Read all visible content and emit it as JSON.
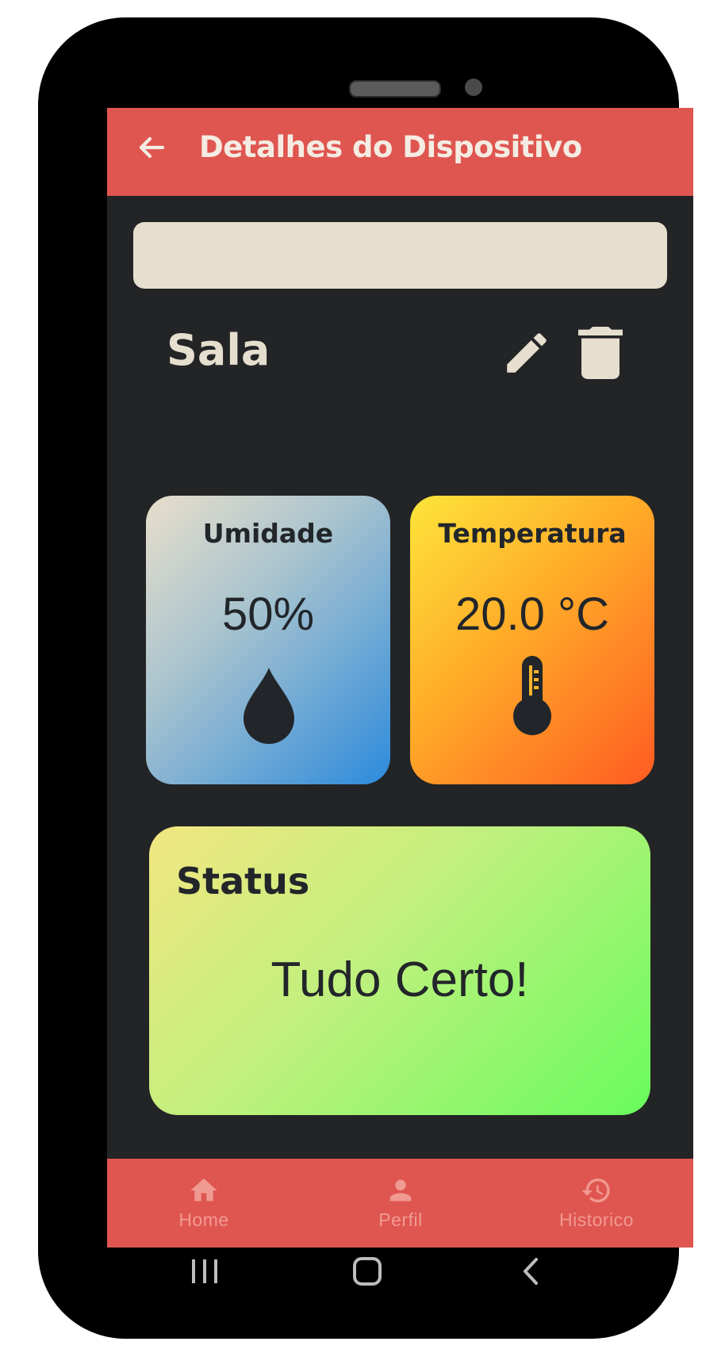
{
  "colors": {
    "app_bar": "#df5651",
    "background": "#232426",
    "banner": "#e6dece",
    "text_light": "#f4ece2",
    "text_dark": "#22262a",
    "nav_label": "#f19a91"
  },
  "header": {
    "back_icon": "arrow-back-icon",
    "title": "Detalhes do Dispositivo"
  },
  "device": {
    "name": "Sala",
    "edit_icon": "pencil-icon",
    "delete_icon": "trash-icon"
  },
  "humidity": {
    "label": "Umidade",
    "value": "50%",
    "icon": "water-drop-icon"
  },
  "temperature": {
    "label": "Temperatura",
    "value": "20.0 °C",
    "icon": "thermometer-icon"
  },
  "status": {
    "label": "Status",
    "message": "Tudo Certo!"
  },
  "bottom_nav": {
    "items": [
      {
        "label": "Home",
        "icon": "home-icon"
      },
      {
        "label": "Perfil",
        "icon": "person-icon"
      },
      {
        "label": "Historico",
        "icon": "history-icon"
      }
    ]
  },
  "system_bar": {
    "recents_icon": "recents-icon",
    "home_icon": "system-home-icon",
    "back_icon": "system-back-icon"
  }
}
